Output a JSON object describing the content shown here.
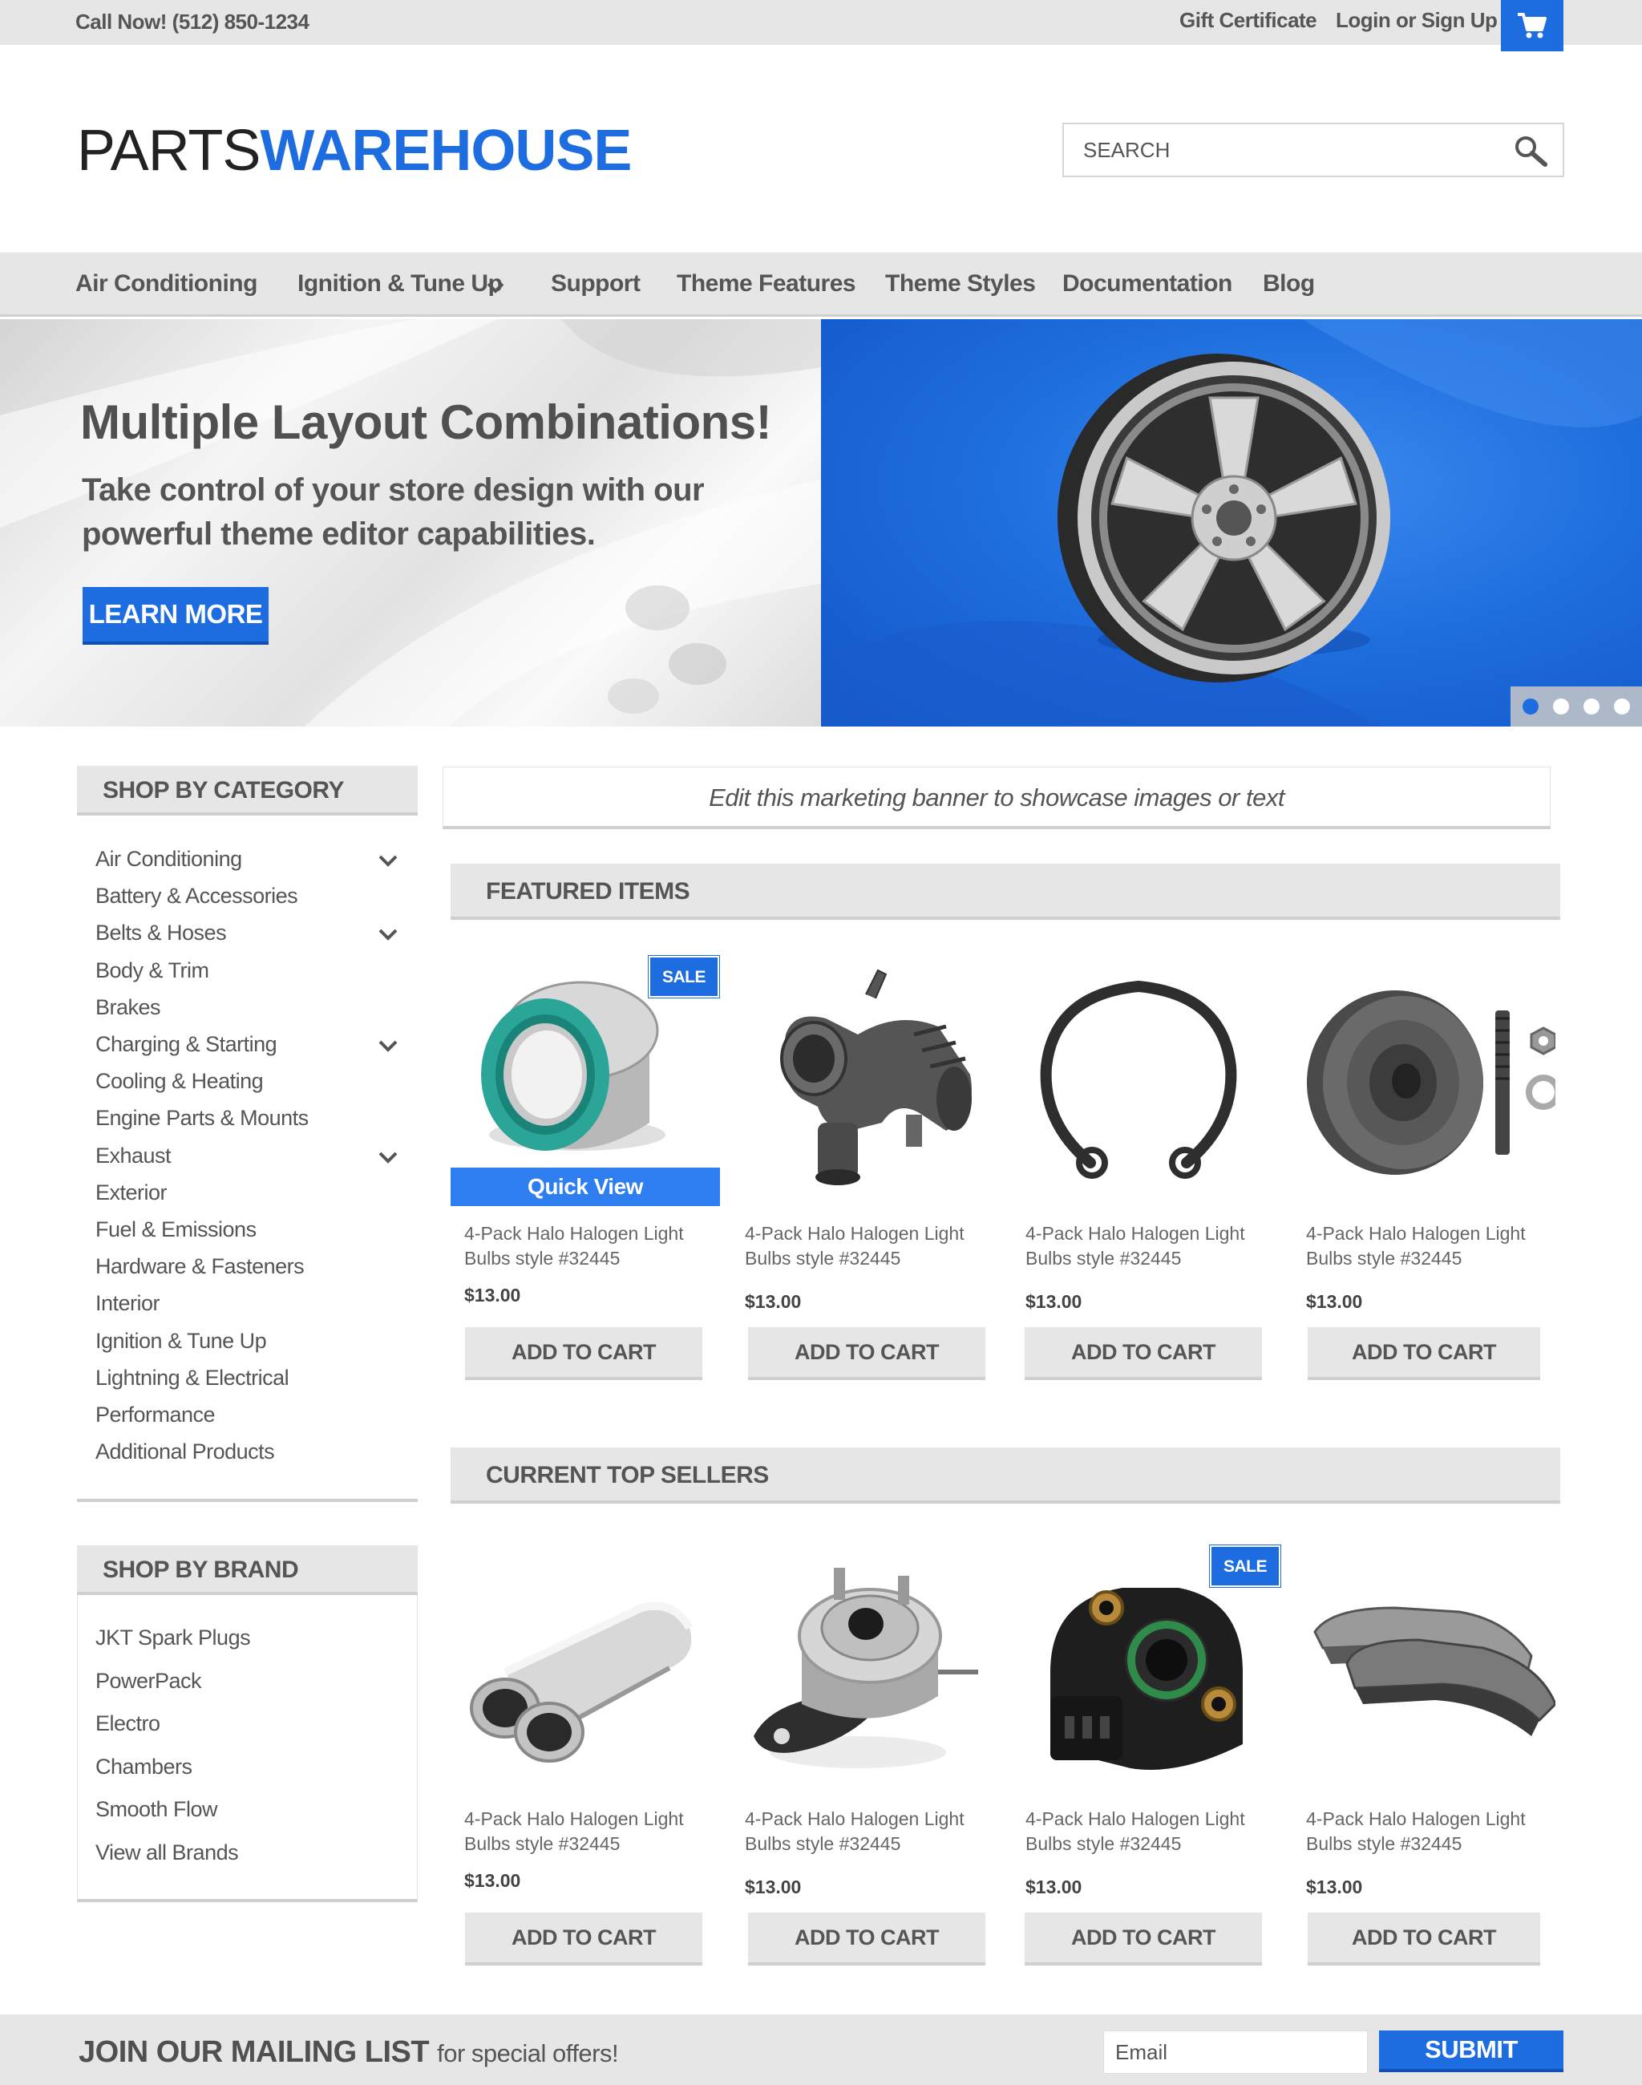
{
  "topbar": {
    "phone": "Call Now! (512) 850-1234",
    "gift": "Gift Certificate",
    "login": "Login or Sign Up",
    "cart_icon": "cart-icon"
  },
  "header": {
    "logo_part1": "PARTS",
    "logo_part2": "WAREHOUSE",
    "search_placeholder": "SEARCH",
    "search_icon": "search-icon"
  },
  "nav": [
    {
      "label": "Air Conditioning"
    },
    {
      "label": "Ignition & Tune Up",
      "has_dropdown": true
    },
    {
      "label": "Support"
    },
    {
      "label": "Theme Features"
    },
    {
      "label": "Theme Styles"
    },
    {
      "label": "Documentation"
    },
    {
      "label": "Blog"
    }
  ],
  "hero": {
    "title": "Multiple Layout Combinations!",
    "subtitle": "Take control of your store design with our powerful theme editor capabilities.",
    "button": "LEARN MORE",
    "slide_count": 4,
    "active_slide": 1
  },
  "sidebar": {
    "category_title": "SHOP BY CATEGORY",
    "categories": [
      {
        "label": "Air Conditioning",
        "expandable": true
      },
      {
        "label": "Battery & Accessories",
        "expandable": false
      },
      {
        "label": "Belts & Hoses",
        "expandable": true
      },
      {
        "label": "Body & Trim",
        "expandable": false
      },
      {
        "label": "Brakes",
        "expandable": false
      },
      {
        "label": "Charging & Starting",
        "expandable": true
      },
      {
        "label": "Cooling & Heating",
        "expandable": false
      },
      {
        "label": "Engine Parts & Mounts",
        "expandable": false
      },
      {
        "label": "Exhaust",
        "expandable": true
      },
      {
        "label": "Exterior",
        "expandable": false
      },
      {
        "label": "Fuel & Emissions",
        "expandable": false
      },
      {
        "label": "Hardware & Fasteners",
        "expandable": false
      },
      {
        "label": "Interior",
        "expandable": false
      },
      {
        "label": "Ignition & Tune Up",
        "expandable": false
      },
      {
        "label": "Lightning & Electrical",
        "expandable": false
      },
      {
        "label": "Performance",
        "expandable": false
      },
      {
        "label": "Additional Products",
        "expandable": false
      }
    ],
    "brand_title": "SHOP BY BRAND",
    "brands": [
      "JKT Spark Plugs",
      "PowerPack",
      "Electro",
      "Chambers",
      "Smooth Flow",
      "View all Brands"
    ]
  },
  "banner": "Edit this marketing banner to showcase images or text",
  "featured": {
    "title": "FEATURED ITEMS",
    "quick_view": "Quick View",
    "products": [
      {
        "name": "4-Pack Halo Halogen Light Bulbs style #32445",
        "price": "$13.00",
        "button": "ADD TO CART",
        "sale": "SALE",
        "icon": "bearing-icon"
      },
      {
        "name": "4-Pack Halo Halogen Light Bulbs style #32445",
        "price": "$13.00",
        "button": "ADD TO CART",
        "sale": "",
        "icon": "intake-hose-icon"
      },
      {
        "name": "4-Pack Halo Halogen Light Bulbs style #32445",
        "price": "$13.00",
        "button": "ADD TO CART",
        "sale": "",
        "icon": "snap-ring-icon"
      },
      {
        "name": "4-Pack Halo Halogen Light Bulbs style #32445",
        "price": "$13.00",
        "button": "ADD TO CART",
        "sale": "",
        "icon": "tensioner-pulley-icon"
      }
    ]
  },
  "top_sellers": {
    "title": "CURRENT TOP SELLERS",
    "products": [
      {
        "name": "4-Pack Halo Halogen Light Bulbs style #32445",
        "price": "$13.00",
        "button": "ADD TO CART",
        "sale": "",
        "icon": "exhaust-tip-icon"
      },
      {
        "name": "4-Pack Halo Halogen Light Bulbs style #32445",
        "price": "$13.00",
        "button": "ADD TO CART",
        "sale": "",
        "icon": "vacuum-actuator-icon"
      },
      {
        "name": "4-Pack Halo Halogen Light Bulbs style #32445",
        "price": "$13.00",
        "button": "ADD TO CART",
        "sale": "SALE",
        "icon": "throttle-sensor-icon"
      },
      {
        "name": "4-Pack Halo Halogen Light Bulbs style #32445",
        "price": "$13.00",
        "button": "ADD TO CART",
        "sale": "",
        "icon": "brake-pads-icon"
      }
    ]
  },
  "footer": {
    "join": "JOIN OUR MAILING LIST",
    "join_sub": "for special offers!",
    "email_placeholder": "Email",
    "submit": "SUBMIT"
  },
  "colors": {
    "accent": "#1e6de0",
    "panel": "#e6e6e6",
    "text": "#555555"
  }
}
